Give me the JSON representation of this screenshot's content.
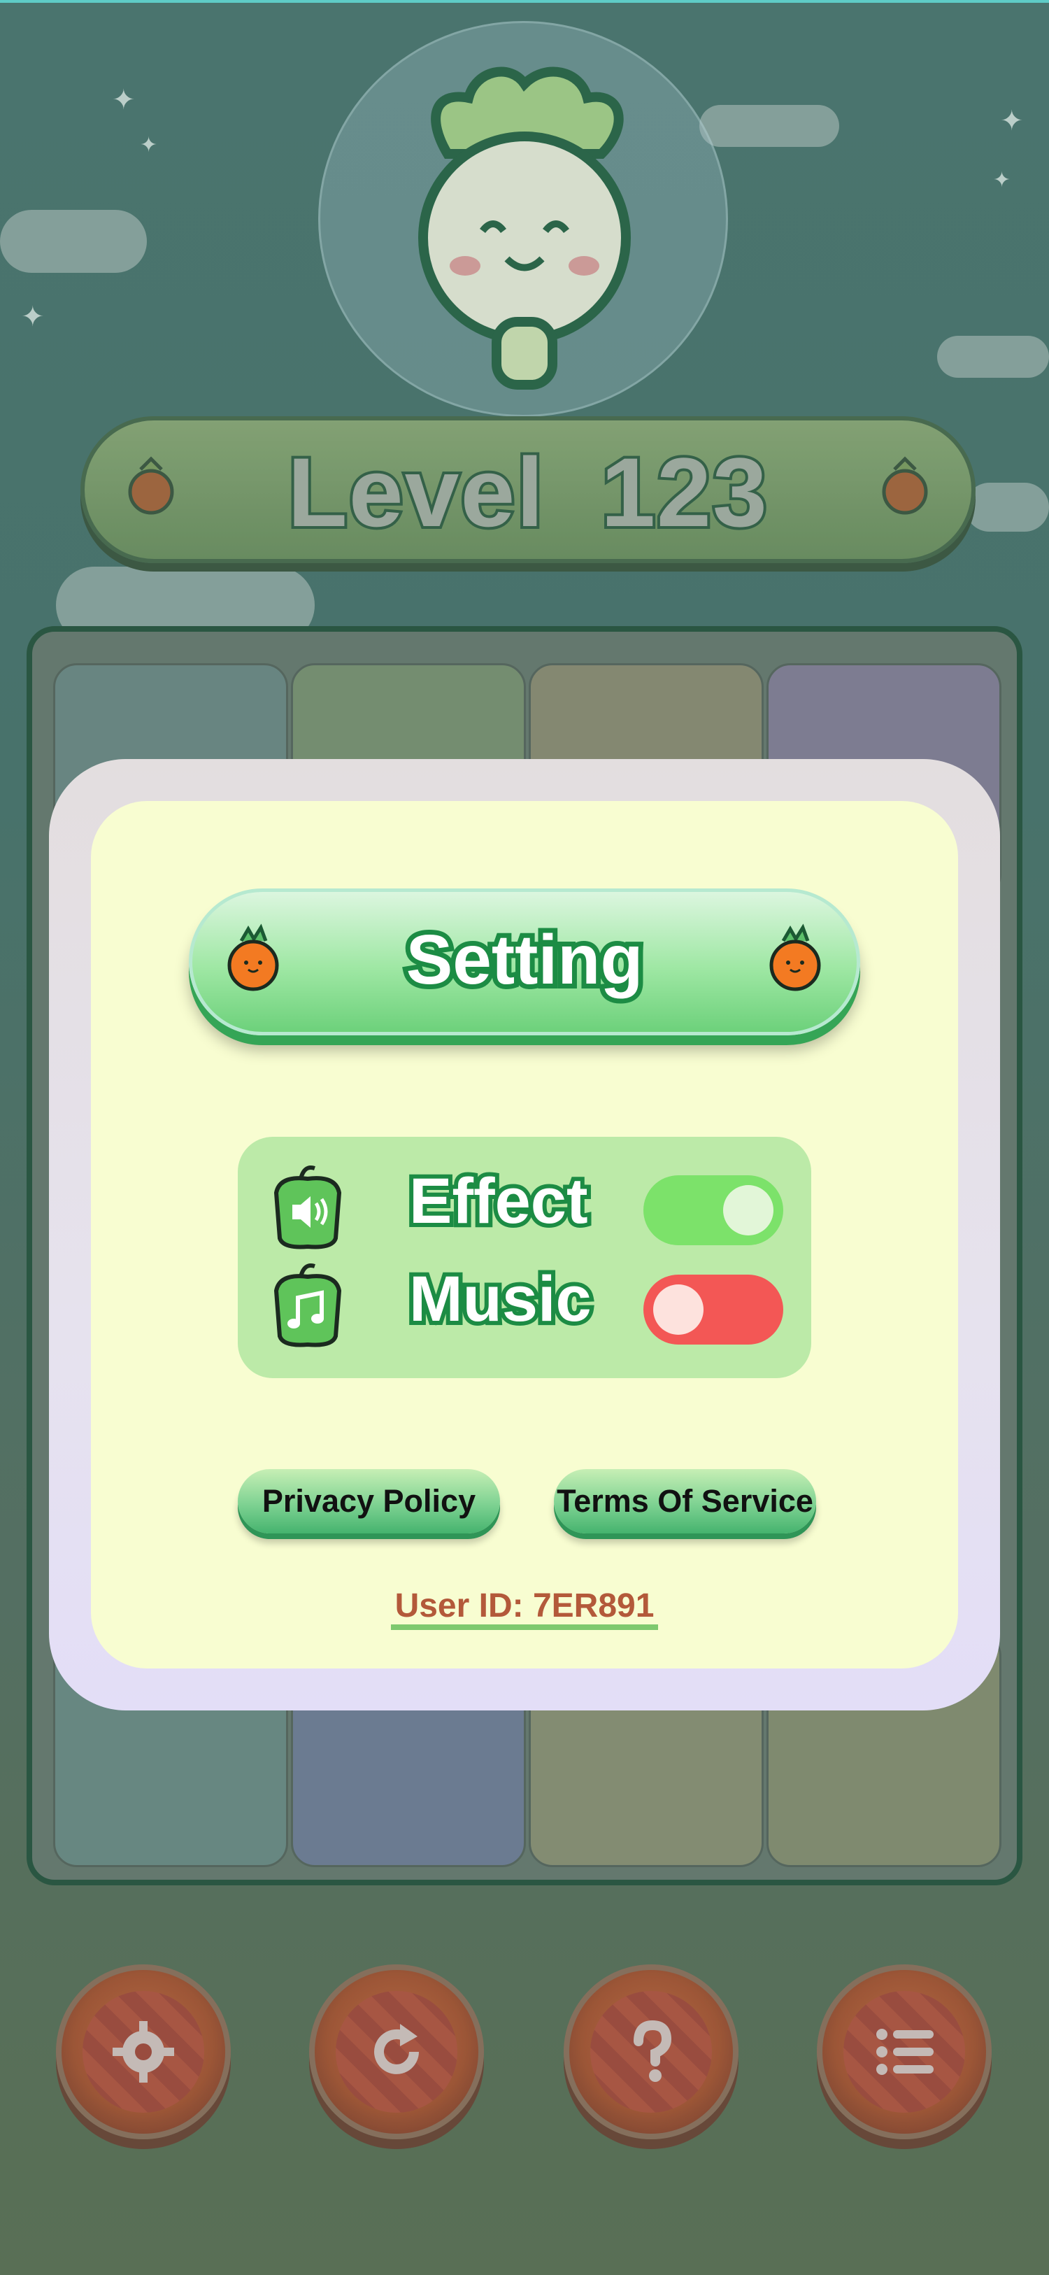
{
  "level": {
    "word": "Level",
    "number": "123"
  },
  "settings": {
    "title": "Setting",
    "items": [
      {
        "label": "Effect",
        "icon": "speaker-pepper-icon",
        "on": true
      },
      {
        "label": "Music",
        "icon": "music-note-pepper-icon",
        "on": false
      }
    ],
    "links": {
      "privacy": "Privacy Policy",
      "terms": "Terms Of Service"
    },
    "user_id": "User ID: 7ER891"
  },
  "bottom_buttons": [
    "gear-icon",
    "restart-icon",
    "help-icon",
    "menu-list-icon"
  ],
  "colors": {
    "toggle_on": "#7ce26a",
    "toggle_off": "#f35755",
    "title_stroke": "#1c8c44",
    "modal_inner": "#f8fdd1"
  }
}
